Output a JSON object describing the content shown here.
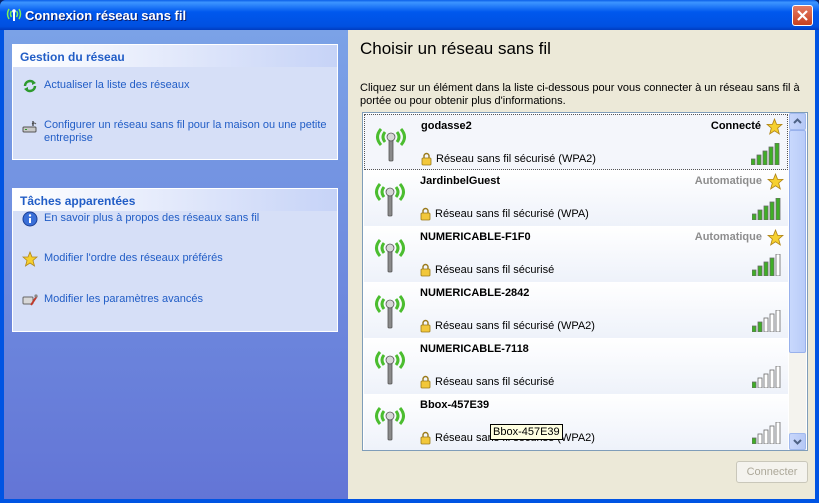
{
  "window": {
    "title": "Connexion réseau sans fil",
    "icon": "wireless-icon"
  },
  "left": {
    "network_tasks": {
      "header": "Gestion du réseau",
      "items": [
        {
          "icon": "refresh-icon",
          "label": "Actualiser la liste des réseaux"
        },
        {
          "icon": "wireless-setup-icon",
          "label": "Configurer un réseau sans fil pour la maison ou une petite entreprise"
        }
      ]
    },
    "related_tasks": {
      "header": "Tâches apparentées",
      "items": [
        {
          "icon": "info-icon",
          "label": "En savoir plus à propos des réseaux sans fil"
        },
        {
          "icon": "star-icon",
          "label": "Modifier l'ordre des réseaux préférés"
        },
        {
          "icon": "settings-icon",
          "label": "Modifier les paramètres avancés"
        }
      ]
    }
  },
  "main": {
    "heading": "Choisir un réseau sans fil",
    "description": "Cliquez sur un élément dans la liste ci-dessous pour vous connecter à un réseau sans fil à portée ou pour obtenir plus d'informations.",
    "networks": [
      {
        "ssid": "godasse2",
        "status": "Connecté",
        "status_style": "bold",
        "preferred": true,
        "security": "Réseau sans fil sécurisé (WPA2)",
        "signal_bars": 5
      },
      {
        "ssid": "JardinbelGuest",
        "status": "Automatique",
        "status_style": "muted",
        "preferred": true,
        "security": "Réseau sans fil sécurisé (WPA)",
        "signal_bars": 5
      },
      {
        "ssid": "NUMERICABLE-F1F0",
        "status": "Automatique",
        "status_style": "muted",
        "preferred": true,
        "security": "Réseau sans fil sécurisé",
        "signal_bars": 4
      },
      {
        "ssid": "NUMERICABLE-2842",
        "status": "",
        "status_style": "",
        "preferred": false,
        "security": "Réseau sans fil sécurisé (WPA2)",
        "signal_bars": 2
      },
      {
        "ssid": "NUMERICABLE-7118",
        "status": "",
        "status_style": "",
        "preferred": false,
        "security": "Réseau sans fil sécurisé",
        "signal_bars": 1
      },
      {
        "ssid": "Bbox-457E39",
        "status": "",
        "status_style": "",
        "preferred": false,
        "security": "Réseau sans fil sécurisé (WPA2)",
        "signal_bars": 1
      }
    ],
    "tooltip": "Bbox-457E39",
    "connect_label": "Connecter"
  },
  "colors": {
    "signal_on": "#3fae26",
    "signal_off": "#ffffff",
    "link": "#215dc6",
    "title_bar": "#0054e3"
  }
}
